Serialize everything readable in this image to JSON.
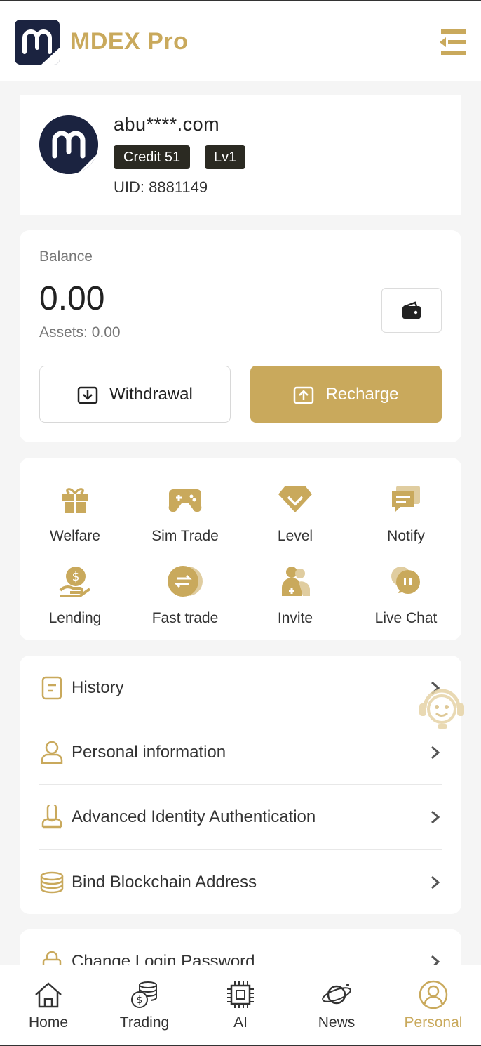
{
  "header": {
    "title": "MDEX Pro",
    "logo_icon": "mdex-logo-icon",
    "menu_icon": "menu-collapse-icon"
  },
  "profile": {
    "username": "abu****.com",
    "credit": "Credit 51",
    "level": "Lv1",
    "uid": "UID: 8881149"
  },
  "balance": {
    "label": "Balance",
    "value": "0.00",
    "assets": "Assets: 0.00",
    "withdraw_label": "Withdrawal",
    "recharge_label": "Recharge"
  },
  "features": [
    {
      "label": "Welfare",
      "icon": "gift-icon"
    },
    {
      "label": "Sim Trade",
      "icon": "gamepad-icon"
    },
    {
      "label": "Level",
      "icon": "diamond-icon"
    },
    {
      "label": "Notify",
      "icon": "message-icon"
    },
    {
      "label": "Lending",
      "icon": "hand-coin-icon"
    },
    {
      "label": "Fast trade",
      "icon": "exchange-coin-icon"
    },
    {
      "label": "Invite",
      "icon": "invite-users-icon"
    },
    {
      "label": "Live Chat",
      "icon": "chat-bubbles-icon"
    }
  ],
  "menu": [
    {
      "label": "History",
      "icon": "document-icon"
    },
    {
      "label": "Personal information",
      "icon": "person-icon"
    },
    {
      "label": "Advanced Identity Authentication",
      "icon": "identity-stamp-icon"
    },
    {
      "label": "Bind Blockchain Address",
      "icon": "database-icon"
    }
  ],
  "menu2": [
    {
      "label": "Change Login Password",
      "icon": "lock-icon"
    }
  ],
  "tabs": [
    {
      "label": "Home",
      "icon": "home-icon"
    },
    {
      "label": "Trading",
      "icon": "coins-icon"
    },
    {
      "label": "AI",
      "icon": "chip-icon"
    },
    {
      "label": "News",
      "icon": "planet-icon"
    },
    {
      "label": "Personal",
      "icon": "user-circle-icon",
      "active": true
    }
  ],
  "colors": {
    "accent": "#c9a95c",
    "dark_badge": "#2b2a22",
    "logo_bg": "#1b2340"
  }
}
